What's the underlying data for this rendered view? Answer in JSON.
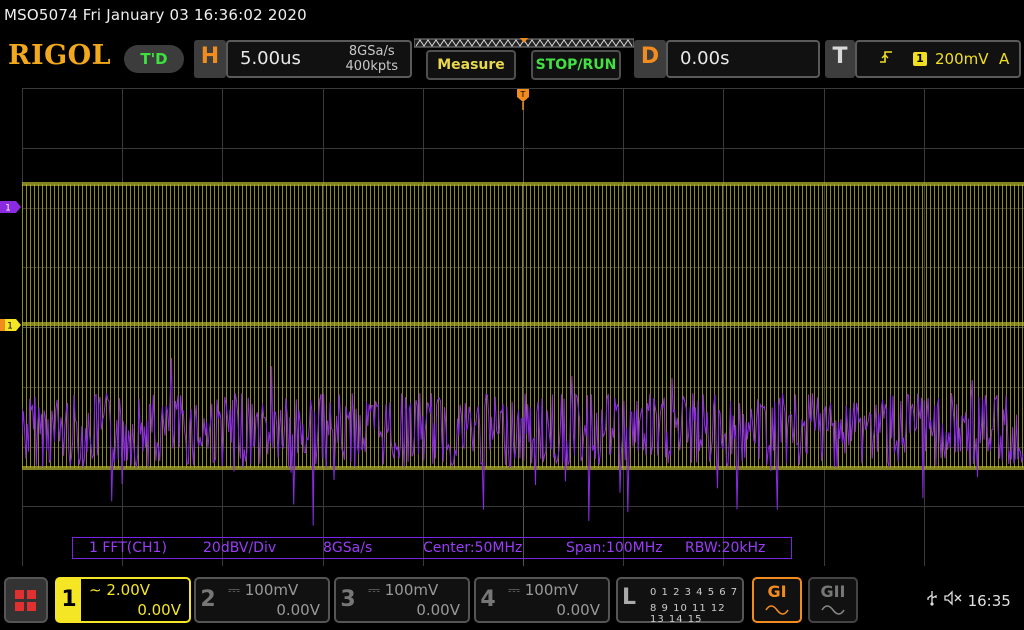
{
  "window": {
    "title": "MSO5074  Fri January 03 16:36:02 2020"
  },
  "header": {
    "logo": "RIGOL",
    "run_state": "T'D",
    "horizontal": {
      "letter": "H",
      "timebase": "5.00us",
      "sample_rate": "8GSa/s",
      "memory_depth": "400kpts"
    },
    "measure_label": "Measure",
    "stoprun_label": "STOP/RUN",
    "delay": {
      "letter": "D",
      "value": "0.00s"
    },
    "trigger": {
      "letter": "T",
      "source": "1",
      "level": "200mV",
      "mode": "A",
      "edge_icon": "rising-edge-icon"
    }
  },
  "markers": {
    "trigger_position": "T",
    "fft_channel": "1",
    "ch1": "1"
  },
  "fft_info": {
    "label": "1 FFT(CH1)",
    "scale": "20dBV/Div",
    "sample_rate": "8GSa/s",
    "center": "Center:50MHz",
    "span": "Span:100MHz",
    "rbw": "RBW:20kHz"
  },
  "channels": [
    {
      "num": "1",
      "coupling_icon": "ac-coupling-icon",
      "scale": "2.00V",
      "offset": "0.00V",
      "color": "#f5e625"
    },
    {
      "num": "2",
      "coupling_icon": "dc-coupling-icon",
      "scale": "100mV",
      "offset": "0.00V",
      "color": "#00e5ff"
    },
    {
      "num": "3",
      "coupling_icon": "dc-coupling-icon",
      "scale": "100mV",
      "offset": "0.00V",
      "color": "#ff40c0"
    },
    {
      "num": "4",
      "coupling_icon": "dc-coupling-icon",
      "scale": "100mV",
      "offset": "0.00V",
      "color": "#3080ff"
    }
  ],
  "logic": {
    "letter": "L",
    "row1": "0 1 2 3  4 5 6 7",
    "row2": "8 9 10 11 12 13 14 15"
  },
  "generators": {
    "g1": "GI",
    "g2": "GII"
  },
  "status": {
    "usb_icon": "usb-icon",
    "sound_icon": "speaker-muted-icon",
    "time": "16:35"
  },
  "colors": {
    "accent": "#f28c1e",
    "ch1": "#f5e625",
    "fft": "#8a2be2",
    "grid": "#3a3a3a"
  }
}
